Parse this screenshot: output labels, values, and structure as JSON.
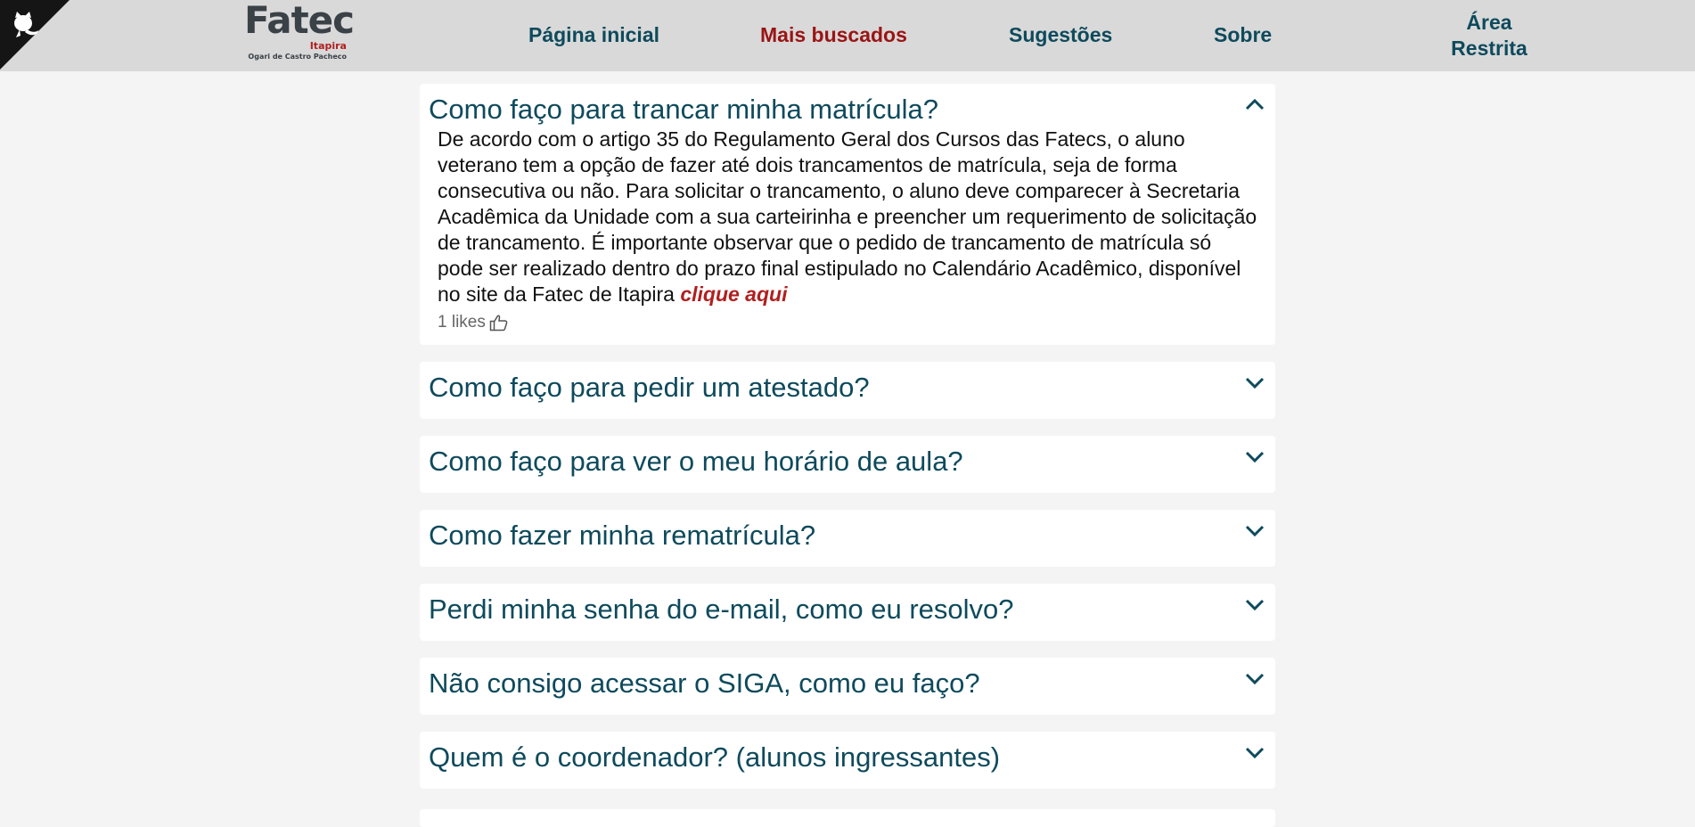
{
  "brand": {
    "name": "Fatec",
    "city": "Itapira",
    "tagline": "Ogari de Castro Pacheco",
    "corner_icon": "github-cat-icon"
  },
  "nav": {
    "home": "Página inicial",
    "popular": "Mais buscados",
    "suggestions": "Sugestões",
    "about": "Sobre",
    "restricted_line1": "Área",
    "restricted_line2": "Restrita"
  },
  "colors": {
    "header_bg": "#d9d9d9",
    "nav_text": "#0e4a5c",
    "nav_active": "#9a1414",
    "link": "#b01f1f",
    "page_bg": "#f4f4f4"
  },
  "faq": [
    {
      "question": "Como faço para trancar minha matrícula?",
      "open": true,
      "answer": "De acordo com o artigo 35 do Regulamento Geral dos Cursos das Fatecs, o aluno veterano tem a opção de fazer até dois trancamentos de matrícula, seja de forma consecutiva ou não. Para solicitar o trancamento, o aluno deve comparecer à Secretaria Acadêmica da Unidade com a sua carteirinha e preencher um requerimento de solicitação de trancamento. É importante observar que o pedido de trancamento de matrícula só pode ser realizado dentro do prazo final estipulado no Calendário Acadêmico, disponível no site da Fatec de Itapira",
      "link_text": "clique aqui",
      "likes": "1 likes"
    },
    {
      "question": "Como faço para pedir um atestado?"
    },
    {
      "question": "Como faço para ver o meu horário de aula?"
    },
    {
      "question": "Como fazer minha rematrícula?"
    },
    {
      "question": "Perdi minha senha do e-mail, como eu resolvo?"
    },
    {
      "question": "Não consigo acessar o SIGA, como eu faço?"
    },
    {
      "question": "Quem é o coordenador? (alunos ingressantes)"
    }
  ]
}
